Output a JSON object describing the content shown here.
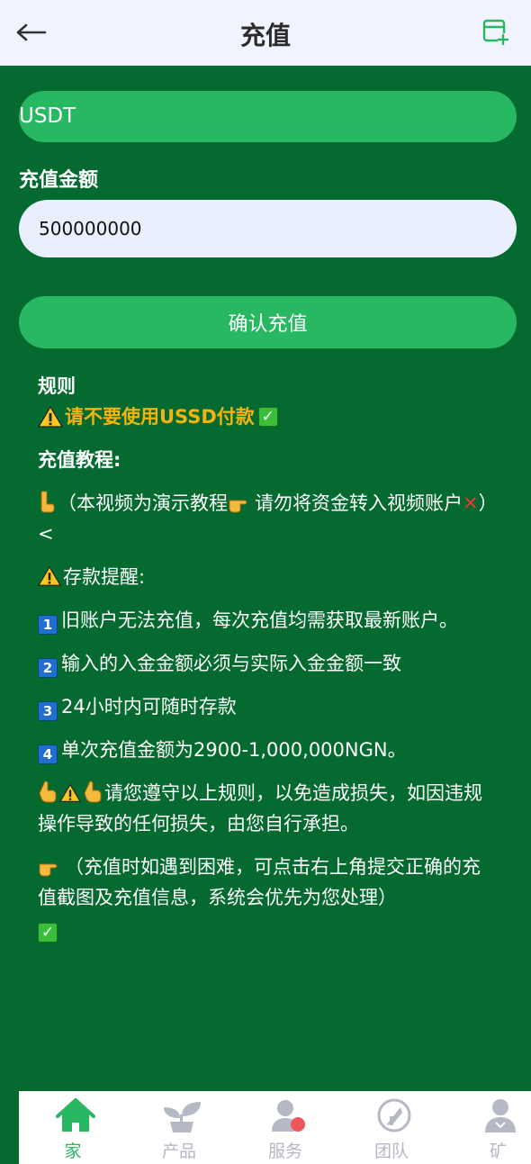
{
  "header": {
    "title": "充值",
    "back_icon": "arrow-left-icon",
    "record_icon": "add-record-icon"
  },
  "form": {
    "currency": "USDT",
    "amount_label": "充值金额",
    "amount_value": "500000000",
    "confirm_label": "确认充值"
  },
  "rules": {
    "title": "规则",
    "warning": "请不要使用USSD付款",
    "tutorial_title": "充值教程:",
    "tutorial_line_a": "（本视频为演示教程",
    "tutorial_line_b": "请勿将资金转入视频账户",
    "tutorial_line_c": "）<",
    "reminder_title": "存款提醒:",
    "items": [
      {
        "num": "1",
        "text": "旧账户无法充值，每次充值均需获取最新账户。"
      },
      {
        "num": "2",
        "text": "输入的入金金额必须与实际入金金额一致"
      },
      {
        "num": "3",
        "text": "24小时内可随时存款"
      },
      {
        "num": "4",
        "text": "单次充值金额为2900-1,000,000NGN。"
      }
    ],
    "notice": "请您遵守以上规则，以免造成损失，如因违规操作导致的任何损失，由您自行承担。",
    "help": "（充值时如遇到困难，可点击右上角提交正确的充值截图及充值信息，系统会优先为您处理）"
  },
  "nav": {
    "items": [
      {
        "label": "家",
        "icon": "home-icon",
        "active": true
      },
      {
        "label": "产品",
        "icon": "sprout-icon",
        "active": false
      },
      {
        "label": "服务",
        "icon": "service-icon",
        "active": false
      },
      {
        "label": "团队",
        "icon": "team-icon",
        "active": false
      },
      {
        "label": "矿",
        "icon": "mine-icon",
        "active": false
      }
    ]
  },
  "colors": {
    "background": "#046a2f",
    "accent": "#28b862",
    "warning": "#f6b20e",
    "header_bg": "#f1f4fe"
  }
}
